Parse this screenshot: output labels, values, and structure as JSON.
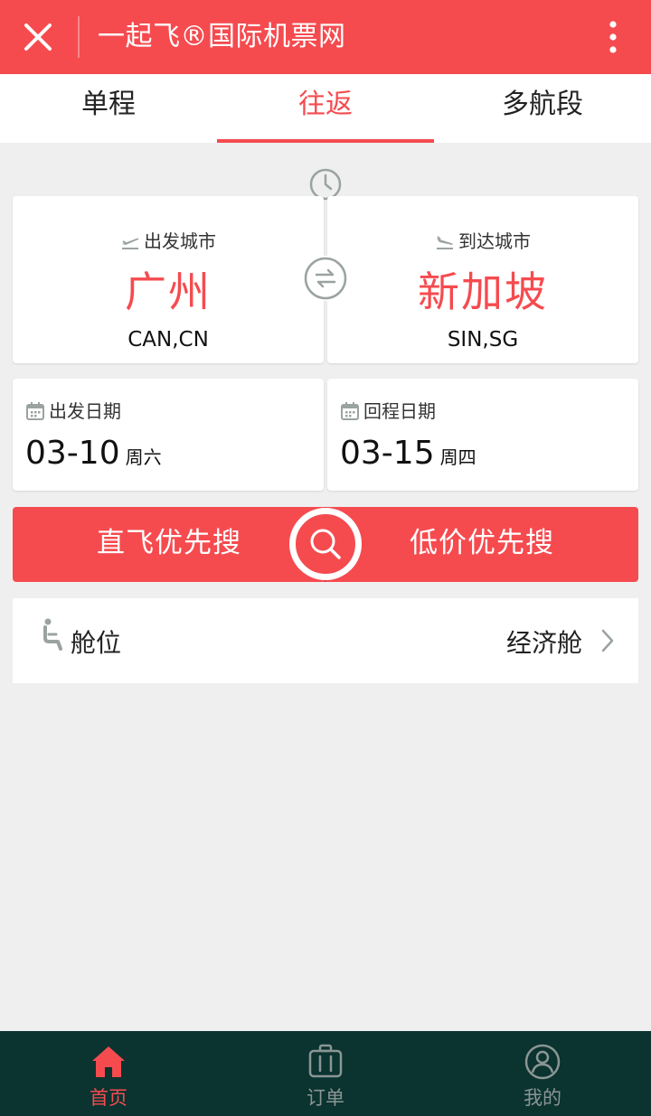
{
  "header": {
    "title": "一起飞®国际机票网"
  },
  "tabs": [
    {
      "label": "单程",
      "active": false
    },
    {
      "label": "往返",
      "active": true
    },
    {
      "label": "多航段",
      "active": false
    }
  ],
  "departure": {
    "label": "出发城市",
    "city": "广州",
    "code": "CAN,CN"
  },
  "arrival": {
    "label": "到达城市",
    "city": "新加坡",
    "code": "SIN,SG"
  },
  "depart_date": {
    "label": "出发日期",
    "date": "03-10",
    "weekday": "周六"
  },
  "return_date": {
    "label": "回程日期",
    "date": "03-15",
    "weekday": "周四"
  },
  "search": {
    "direct_label": "直飞优先搜",
    "lowprice_label": "低价优先搜"
  },
  "cabin": {
    "label": "舱位",
    "value": "经济舱"
  },
  "bottom_nav": [
    {
      "label": "首页",
      "icon": "home-icon",
      "active": true
    },
    {
      "label": "订单",
      "icon": "luggage-icon",
      "active": false
    },
    {
      "label": "我的",
      "icon": "user-icon",
      "active": false
    }
  ],
  "colors": {
    "primary": "#f54b4f",
    "nav_bg": "#0b3330",
    "page_bg": "#efefef",
    "icon_gray": "#9aa3a1"
  }
}
